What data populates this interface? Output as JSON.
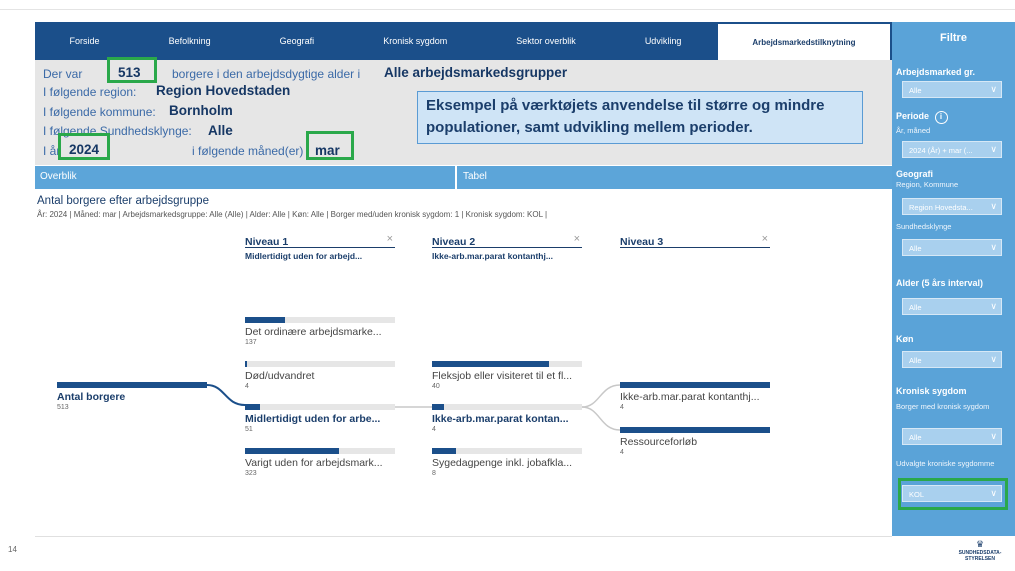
{
  "nav": {
    "tabs": [
      {
        "label": "Forside"
      },
      {
        "label": "Befolkning"
      },
      {
        "label": "Geografi"
      },
      {
        "label": "Kronisk sygdom"
      },
      {
        "label": "Sektor overblik"
      },
      {
        "label": "Udvikling"
      },
      {
        "label": "Arbejdsmarkedstilknytning"
      }
    ]
  },
  "info": {
    "der_var": "Der var",
    "count": "513",
    "borgere_text": "borgere i den arbejdsdygtige alder i",
    "group": "Alle arbejdsmarkedsgrupper",
    "region_label": "I følgende region:",
    "region": "Region Hovedstaden",
    "kommune_label": "I følgende kommune:",
    "kommune": "Bornholm",
    "klynge_label": "I følgende Sundhedsklynge:",
    "klynge": "Alle",
    "aar_label": "I år",
    "aar": "2024",
    "maaned_label": "i følgende måned(er)",
    "maaned": "mar"
  },
  "note": "Eksempel på værktøjets anvendelse til større og mindre populationer, samt udvikling mellem perioder.",
  "tabs": {
    "overblik": "Overblik",
    "tabel": "Tabel"
  },
  "chart": {
    "title": "Antal borgere efter arbejdsgruppe",
    "subtitle": "År: 2024 | Måned: mar | Arbejdsmarkedsgruppe: Alle (Alle) | Alder: Alle | Køn: Alle | Borger med/uden kronisk sygdom: 1 | Kronisk sygdom: KOL |",
    "levels": [
      {
        "title": "Niveau 1",
        "selected": "Midlertidigt uden for arbejd..."
      },
      {
        "title": "Niveau 2",
        "selected": "Ikke-arb.mar.parat kontanthj..."
      },
      {
        "title": "Niveau 3",
        "selected": ""
      }
    ],
    "close_glyph": "×",
    "root": {
      "label": "Antal borgere",
      "count": "513"
    },
    "level1": [
      {
        "label": "Det ordinære arbejdsmarke...",
        "count": "137"
      },
      {
        "label": "Død/udvandret",
        "count": "4"
      },
      {
        "label": "Midlertidigt uden for arbe...",
        "count": "51"
      },
      {
        "label": "Varigt uden for arbejdsmark...",
        "count": "323"
      }
    ],
    "level2": [
      {
        "label": "Fleksjob eller visiteret til et fl...",
        "count": "40"
      },
      {
        "label": "Ikke-arb.mar.parat kontan...",
        "count": "4"
      },
      {
        "label": "Sygedagpenge inkl. jobafkla...",
        "count": "8"
      }
    ],
    "level3": [
      {
        "label": "Ikke-arb.mar.parat kontanthj...",
        "count": "4"
      },
      {
        "label": "Ressourceforløb",
        "count": "4"
      }
    ]
  },
  "sidebar": {
    "title": "Filtre",
    "arbejdsmarked_label": "Arbejdsmarked gr.",
    "arbejdsmarked_value": "Alle",
    "periode_label": "Periode",
    "periode_sub": "År, måned",
    "periode_value": "2024 (År) + mar (...",
    "geografi_label": "Geografi",
    "geografi_sub": "Region, Kommune",
    "geografi_value": "Region Hovedsta...",
    "klynge_label": "Sundhedsklynge",
    "klynge_value": "Alle",
    "alder_label": "Alder (5 års interval)",
    "alder_value": "Alle",
    "koen_label": "Køn",
    "koen_value": "Alle",
    "kronisk_label": "Kronisk sygdom",
    "kronisk_sub": "Borger med kronisk sygdom",
    "kronisk_value": "Alle",
    "udvalgte_label": "Udvalgte kroniske sygdomme",
    "udvalgte_value": "KOL",
    "chevron": "∨",
    "info_glyph": "i"
  },
  "footer": {
    "page": "14",
    "logo_line1": "SUNDHEDSDATA-",
    "logo_line2": "STYRELSEN",
    "crown": "♛"
  },
  "colors": {
    "accent": "#2aa84a",
    "nav": "#1b4f8a",
    "sidebar": "#5aa3d8",
    "bar": "#1b4f8a"
  }
}
